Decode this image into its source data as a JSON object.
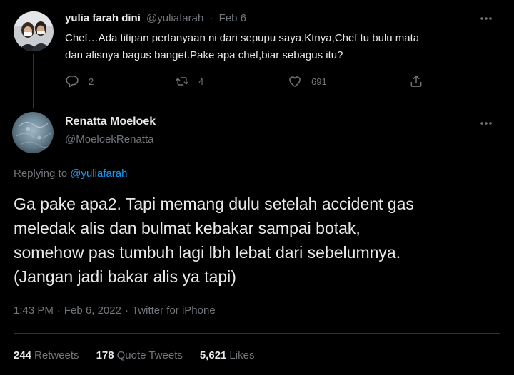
{
  "parent_tweet": {
    "display_name": "yulia farah dini",
    "handle": "@yuliafarah",
    "separator": "·",
    "date": "Feb 6",
    "text_line1": "Chef…Ada titipan pertanyaan ni dari sepupu saya.Ktnya,Chef tu bulu mata",
    "text_line2": "dan alisnya bagus banget.Pake apa chef,biar sebagus itu?",
    "reply_count": "2",
    "retweet_count": "4",
    "like_count": "691",
    "icons": [
      "reply-icon",
      "retweet-icon",
      "like-icon",
      "share-icon",
      "more-icon"
    ]
  },
  "main_tweet": {
    "display_name": "Renatta Moeloek",
    "handle": "@MoeloekRenatta",
    "replying_prefix": "Replying to",
    "replying_mention": "@yuliafarah",
    "text_lines": [
      "Ga pake apa2. Tapi memang dulu setelah accident gas",
      "meledak alis dan bulmat kebakar sampai botak,",
      "somehow pas tumbuh lagi lbh lebat dari sebelumnya.",
      "(Jangan jadi bakar alis ya tapi)"
    ],
    "time": "1:43 PM",
    "date": "Feb 6, 2022",
    "source": "Twitter for iPhone",
    "separator": "·"
  },
  "stats": [
    {
      "count": "244",
      "label": "Retweets"
    },
    {
      "count": "178",
      "label": "Quote Tweets"
    },
    {
      "count": "5,621",
      "label": "Likes"
    }
  ],
  "colors": {
    "background": "#000000",
    "primary_text": "#e7e9ea",
    "secondary_text": "#71767b",
    "link": "#1d9bf0",
    "divider": "#2f3336"
  }
}
